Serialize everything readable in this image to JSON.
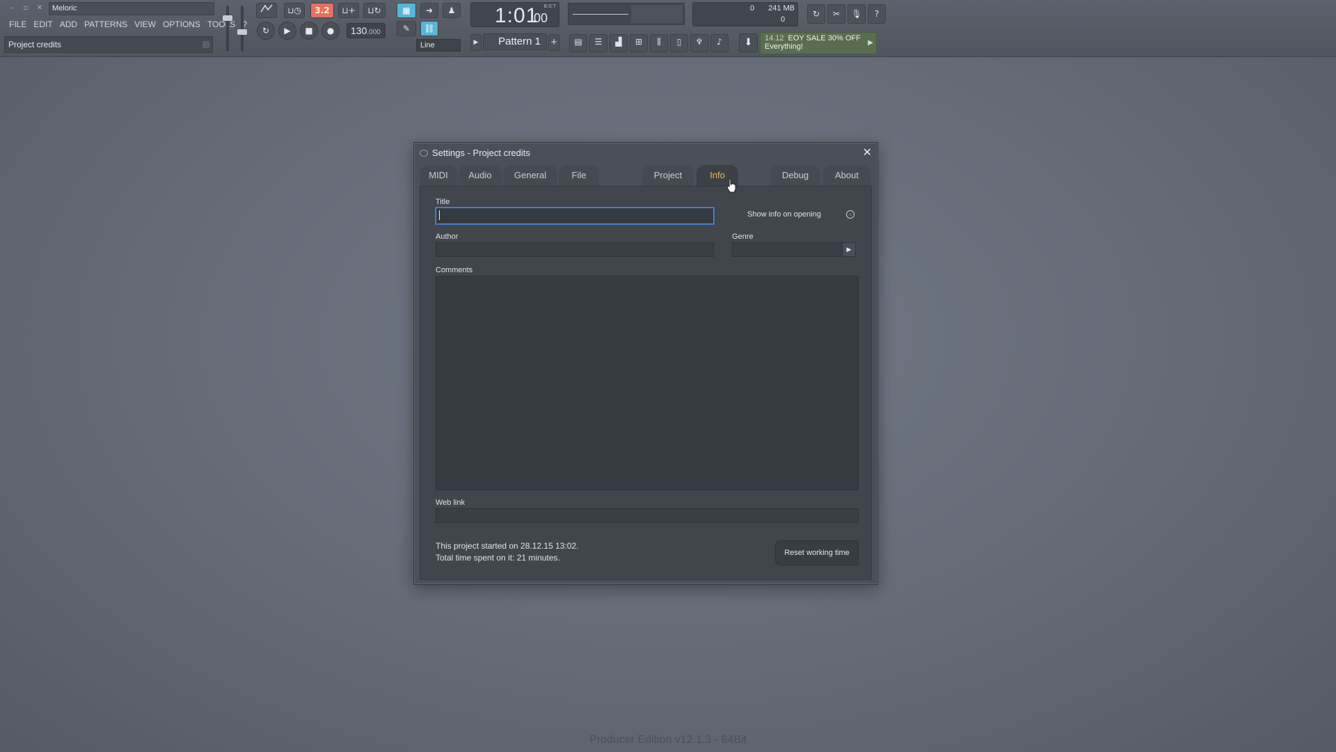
{
  "app": {
    "name": "Meloric",
    "window_controls": [
      "–",
      "▫",
      "✕"
    ],
    "menu": [
      "FILE",
      "EDIT",
      "ADD",
      "PATTERNS",
      "VIEW",
      "OPTIONS",
      "TOOLS",
      "?"
    ],
    "hint": "Project credits"
  },
  "toolbar": {
    "pattern_mode_label": "3.2",
    "tempo_value": "130",
    "tempo_decimal": ".000",
    "time_main": "1:01",
    "time_sub": "00",
    "time_format": "B:S:T",
    "snap_label": "Line",
    "pattern_label": "Pattern 1",
    "memory_value": "241 MB",
    "cpu_value": "0",
    "poly_value": "0",
    "news": {
      "number": "14.12",
      "text_line1": "EOY SALE 30% OFF",
      "text_line2": "Everything!"
    }
  },
  "dialog": {
    "title": "Settings - Project credits",
    "tabs": [
      {
        "label": "MIDI",
        "active": false
      },
      {
        "label": "Audio",
        "active": false
      },
      {
        "label": "General",
        "active": false
      },
      {
        "label": "File",
        "active": false
      },
      {
        "label": "Project",
        "active": false
      },
      {
        "label": "Info",
        "active": true
      },
      {
        "label": "Debug",
        "active": false
      },
      {
        "label": "About",
        "active": false
      }
    ],
    "fields": {
      "title_label": "Title",
      "title_value": "",
      "show_info_label": "Show info on opening",
      "author_label": "Author",
      "author_value": "",
      "genre_label": "Genre",
      "genre_value": "",
      "comments_label": "Comments",
      "comments_value": "",
      "weblink_label": "Web link",
      "weblink_value": ""
    },
    "status_line1": "This project started on 28.12.15 13:02.",
    "status_line2": "Total time spent on it: 21 minutes.",
    "reset_button": "Reset working time"
  },
  "footer": {
    "version": "Producer Edition v12.1.3 - 64Bit"
  },
  "colors": {
    "active_tab": "#f0b450",
    "focus_border": "#5b8ad6",
    "news_bg": "#596d51",
    "pattern_mode_bg": "#e66f62"
  }
}
